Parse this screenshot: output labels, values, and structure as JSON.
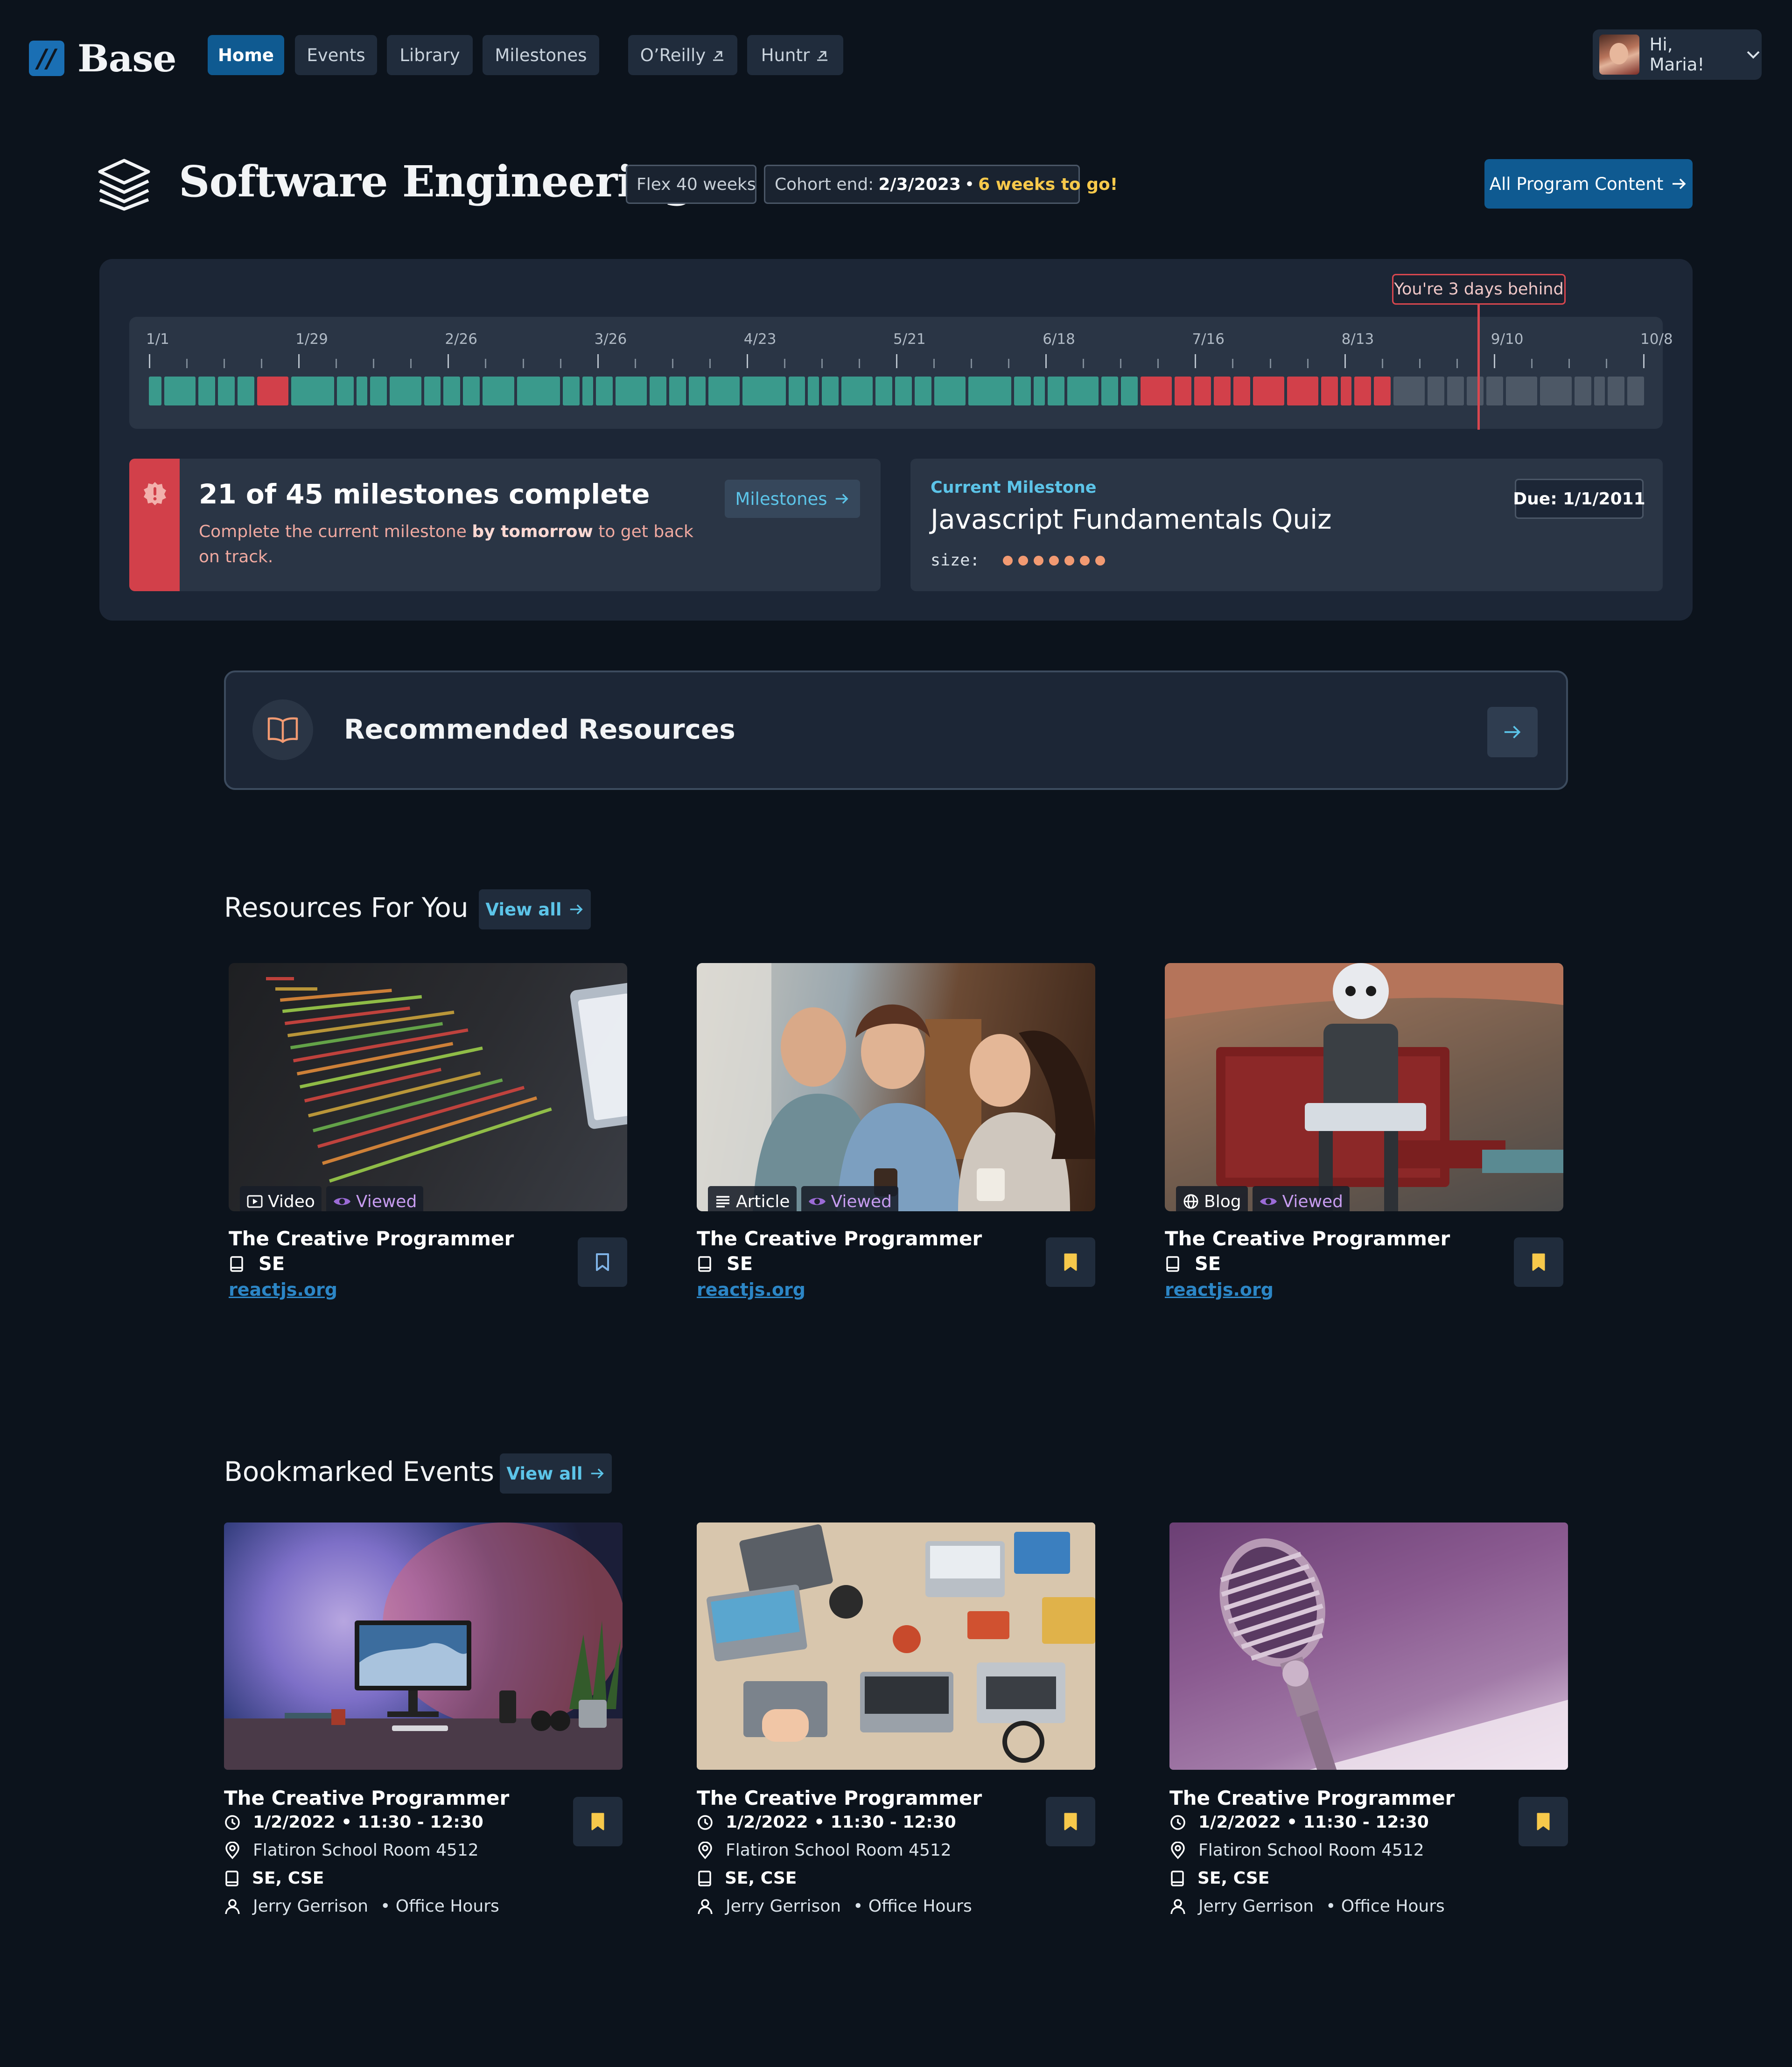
{
  "nav": {
    "logo_mark": "//",
    "logo_text": "Base",
    "tabs": [
      {
        "label": "Home",
        "active": true
      },
      {
        "label": "Events",
        "active": false
      },
      {
        "label": "Library",
        "active": false
      },
      {
        "label": "Milestones",
        "active": false
      }
    ],
    "external": [
      {
        "label": "O’Reilly"
      },
      {
        "label": "Huntr"
      }
    ],
    "user": {
      "greeting": "Hi, Maria!"
    }
  },
  "header": {
    "title": "Software Engineering",
    "flex_chip": "Flex 40 weeks",
    "cohort_label": "Cohort end:",
    "cohort_date": "2/3/2023",
    "cohort_remaining": "6 weeks to go!",
    "program_button": "All Program Content"
  },
  "timeline": {
    "status_tag": "You're 3 days behind",
    "date_labels": [
      "1/1",
      "1/29",
      "2/26",
      "3/26",
      "4/23",
      "5/21",
      "6/18",
      "7/16",
      "8/13",
      "9/10",
      "10/8"
    ],
    "milestone_status_counts": {
      "done": 40,
      "missed": 11,
      "upcoming": 11
    },
    "colors": {
      "done": "#3a9a8c",
      "missed": "#d2404a",
      "upcoming": "#4d5866",
      "today": "#d9474f"
    }
  },
  "milestones_card": {
    "title": "21 of 45 milestones complete",
    "sub_before": "Complete the current milestone ",
    "sub_bold": "by tomorrow",
    "sub_after": " to get back on track.",
    "button": "Milestones"
  },
  "current_milestone": {
    "eyebrow": "Current Milestone",
    "title": "Javascript Fundamentals Quiz",
    "size_label": "size:",
    "size_dots": 7,
    "due": "Due: 1/1/2011"
  },
  "recommended": {
    "title": "Recommended Resources",
    "icon": "open-book-icon"
  },
  "resources": {
    "heading": "Resources For You",
    "view_all": "View all",
    "items": [
      {
        "type": "Video",
        "type_icon": "video-icon",
        "viewed": "Viewed",
        "title": "The Creative Programmer",
        "program": "SE",
        "link": "reactjs.org",
        "bookmarked": false
      },
      {
        "type": "Article",
        "type_icon": "article-icon",
        "viewed": "Viewed",
        "title": "The Creative Programmer",
        "program": "SE",
        "link": "reactjs.org",
        "bookmarked": true
      },
      {
        "type": "Blog",
        "type_icon": "globe-icon",
        "viewed": "Viewed",
        "title": "The Creative Programmer",
        "program": "SE",
        "link": "reactjs.org",
        "bookmarked": true
      }
    ]
  },
  "events": {
    "heading": "Bookmarked Events",
    "view_all": "View all",
    "items": [
      {
        "title": "The Creative Programmer",
        "datetime": "1/2/2022 • 11:30 - 12:30",
        "location": "Flatiron School Room 4512",
        "programs": "SE, CSE",
        "host": "Jerry Gerrison",
        "kind": "• Office Hours"
      },
      {
        "title": "The Creative Programmer",
        "datetime": "1/2/2022 • 11:30 - 12:30",
        "location": "Flatiron School Room 4512",
        "programs": "SE, CSE",
        "host": "Jerry Gerrison",
        "kind": "• Office Hours"
      },
      {
        "title": "The Creative Programmer",
        "datetime": "1/2/2022 • 11:30 - 12:30",
        "location": "Flatiron School Room 4512",
        "programs": "SE, CSE",
        "host": "Jerry Gerrison",
        "kind": "• Office Hours"
      }
    ]
  },
  "colors": {
    "background": "#0c131c",
    "accent_blue": "#0f5a91",
    "link_cyan": "#5cc4e8",
    "warning_yellow": "#f7c94b",
    "alert_red": "#d2404a",
    "bookmark_yellow": "#f7c94b",
    "viewed_purple": "#c79cf0"
  }
}
